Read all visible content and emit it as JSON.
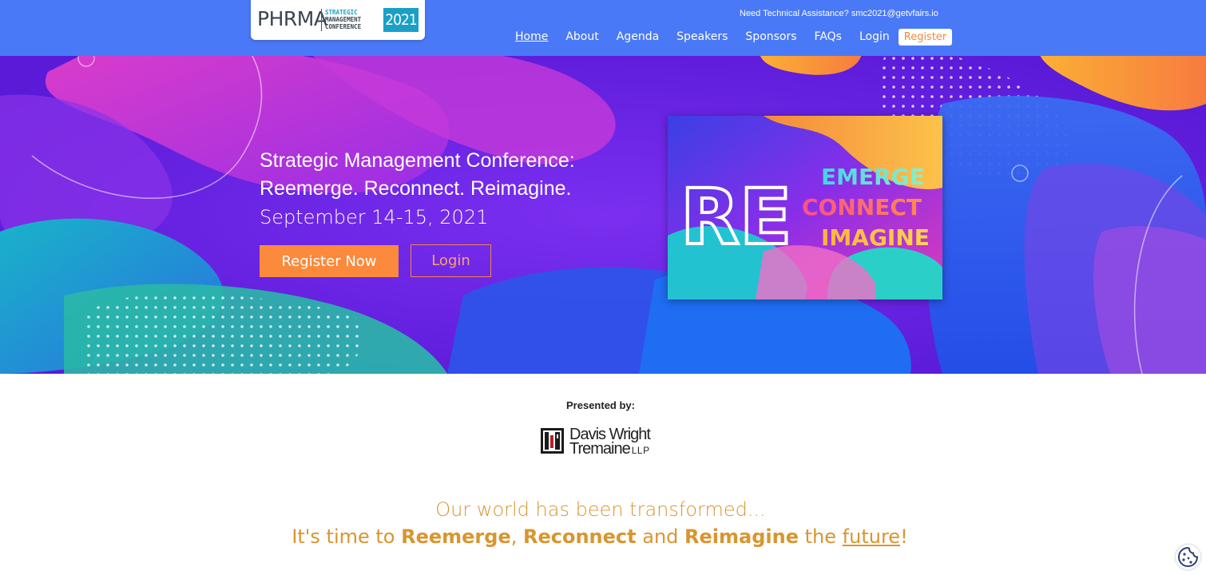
{
  "header": {
    "logo": {
      "word": "PHRMA",
      "line1": "STRATEGIC",
      "line2": "MANAGEMENT",
      "line3": "CONFERENCE",
      "year": "2021"
    },
    "tech_assist": "Need Technical Assistance? smc2021@getvfairs.io",
    "nav": [
      {
        "label": "Home",
        "active": true
      },
      {
        "label": "About"
      },
      {
        "label": "Agenda"
      },
      {
        "label": "Speakers"
      },
      {
        "label": "Sponsors"
      },
      {
        "label": "FAQs"
      },
      {
        "label": "Login"
      }
    ],
    "register_label": "Register"
  },
  "hero": {
    "title_line1": "Strategic Management Conference:",
    "title_line2": "Reemerge. Reconnect. Reimagine.",
    "date": "September 14-15, 2021",
    "register_now_label": "Register Now",
    "login_label": "Login",
    "image": {
      "big": "RE",
      "word1": "EMERGE",
      "word2": "CONNECT",
      "word3": "IMAGINE"
    }
  },
  "presented": {
    "label": "Presented by:",
    "sponsor_line1": "Davis Wright",
    "sponsor_line2": "Tremaine",
    "sponsor_suffix": "LLP"
  },
  "tagline": {
    "line1": "Our world has been transformed...",
    "part1": "It's time to ",
    "word1": "Reemerge",
    "sep1": ", ",
    "word2": "Reconnect",
    "mid": " and ",
    "word3": "Reimagine",
    "the": " the ",
    "future": "future",
    "end": "!"
  },
  "colors": {
    "nav_bg": "#4a79f7",
    "accent_orange": "#fb8a3c",
    "tagline": "#d9952e"
  }
}
